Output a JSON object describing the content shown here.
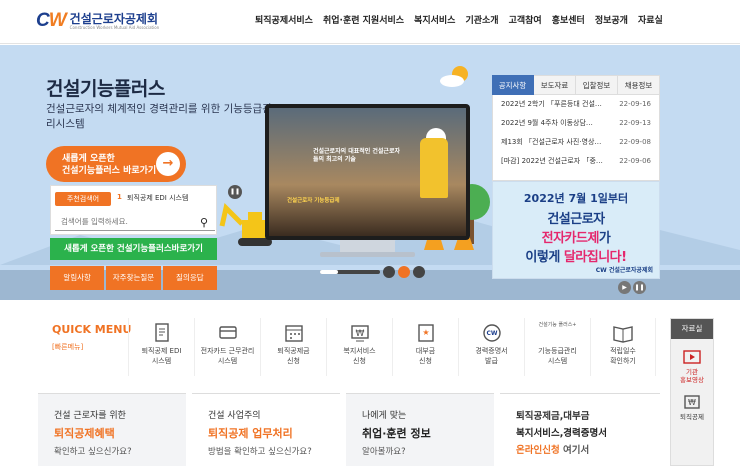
{
  "header": {
    "logo_mark": "CW",
    "logo_name": "건설근로자공제회",
    "logo_sub": "Construction Workers Mutual Aid Association",
    "nav": [
      "퇴직공제서비스",
      "취업·훈련 지원서비스",
      "복지서비스",
      "기관소개",
      "고객참여",
      "홍보센터",
      "정보공개",
      "자료실"
    ]
  },
  "hero": {
    "title": "건설기능플러스",
    "subtitle": "건설근로자의 체계적인 경력관리를 위한 기능등급관리시스템",
    "cta_line1": "새롭게 오픈한",
    "cta_line2": "건설기능플러스 바로가기",
    "cta_arrow": "→",
    "search_tag": "주천검색어",
    "search_rank": "1",
    "search_keyword": "퇴직공제 EDI 시스템",
    "search_placeholder": "검색어를 입력하세요.",
    "green_button": "새롭게 오픈한 건설기능플러스바로가기",
    "orange_buttons": [
      "알림사항",
      "자주찾는질문",
      "질의응답"
    ],
    "monitor_text1": "건설근로자의 대표적인 건설근로자들의 최고의 기술",
    "monitor_text2": "건설근로자 기능등급제"
  },
  "notice": {
    "tabs": [
      "공지사항",
      "보도자료",
      "입찰정보",
      "채용정보"
    ],
    "items": [
      {
        "title": "2022년 2학기 「푸른등대 건설…",
        "date": "22-09-16"
      },
      {
        "title": "2022년 9월 4주차 이동상담…",
        "date": "22-09-13"
      },
      {
        "title": "제13회 「건설근로자 사진·영상…",
        "date": "22-09-08"
      },
      {
        "title": "[마감] 2022년 건설근로자 「중…",
        "date": "22-09-06"
      }
    ]
  },
  "banner": {
    "line1": "2022년 7월 1일부터",
    "line2": "건설근로자",
    "line3a": "전자카드제",
    "line3b": "가",
    "line4a": "이렇게 ",
    "line4b": "달라집니다!",
    "logo": "CW 건설근로자공제회"
  },
  "quick_menu": {
    "title": "QUICK MENU",
    "subtitle": "[빠른메뉴]",
    "items": [
      {
        "label1": "퇴직공제 EDI",
        "label2": "시스템",
        "icon": "document-icon"
      },
      {
        "label1": "전자카드 근무관리",
        "label2": "시스템",
        "icon": "card-icon"
      },
      {
        "label1": "퇴직공제금",
        "label2": "신청",
        "icon": "calendar-icon"
      },
      {
        "label1": "복지서비스",
        "label2": "신청",
        "icon": "won-icon"
      },
      {
        "label1": "대부금",
        "label2": "신청",
        "icon": "star-icon"
      },
      {
        "label1": "경력증명서",
        "label2": "발급",
        "icon": "cw-badge-icon"
      },
      {
        "label1": "기능등급관리",
        "label2": "시스템",
        "icon": "plus-icon"
      },
      {
        "label1": "적립일수",
        "label2": "확인하기",
        "icon": "book-icon"
      }
    ],
    "icon_inner": {
      "plus": "건설기능 플러스+"
    }
  },
  "cards": [
    {
      "l1": "건설 근로자를 위한",
      "l2a": "퇴직공제혜택",
      "l2b": "",
      "l3": "확인하고 싶으신가요?"
    },
    {
      "l1": "건설 사업주의",
      "l2a": "퇴직공제 업무처리",
      "l2b": "",
      "l3": "방법을 확인하고 싶으신가요?"
    },
    {
      "l1": "나에게 맞는",
      "l2a": "취업·훈련 정보",
      "l2b": "",
      "l3": "알아볼까요?"
    },
    {
      "l1": "퇴직공제금,대부금",
      "l2a": "복지서비스,경력증명서",
      "l2b": "온라인신청",
      "l3": "여기서"
    }
  ],
  "rail": {
    "title": "자료실",
    "items": [
      {
        "l1": "기관",
        "l2": "홍보영상"
      },
      {
        "l1": "퇴직공제",
        "l2": ""
      }
    ]
  },
  "colors": {
    "accent": "#f07324",
    "primary": "#1d3f8e",
    "green": "#2bb24c",
    "hero_bg": "#c4dbf2"
  }
}
